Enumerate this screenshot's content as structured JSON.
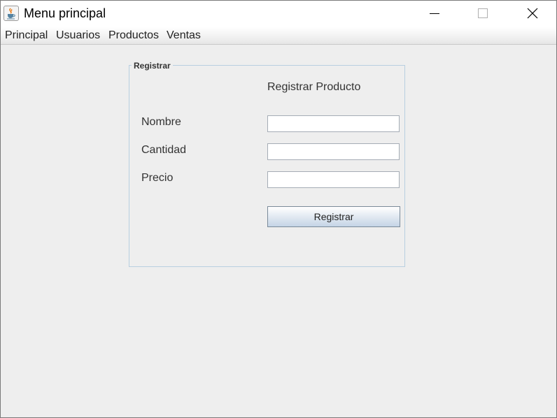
{
  "window": {
    "title": "Menu principal",
    "icon": "java-cup-icon"
  },
  "menubar": {
    "items": [
      "Principal",
      "Usuarios",
      "Productos",
      "Ventas"
    ]
  },
  "form": {
    "legend": "Registrar",
    "heading": "Registrar Producto",
    "fields": [
      {
        "label": "Nombre",
        "value": ""
      },
      {
        "label": "Cantidad",
        "value": ""
      },
      {
        "label": "Precio",
        "value": ""
      }
    ],
    "submit_label": "Registrar"
  }
}
